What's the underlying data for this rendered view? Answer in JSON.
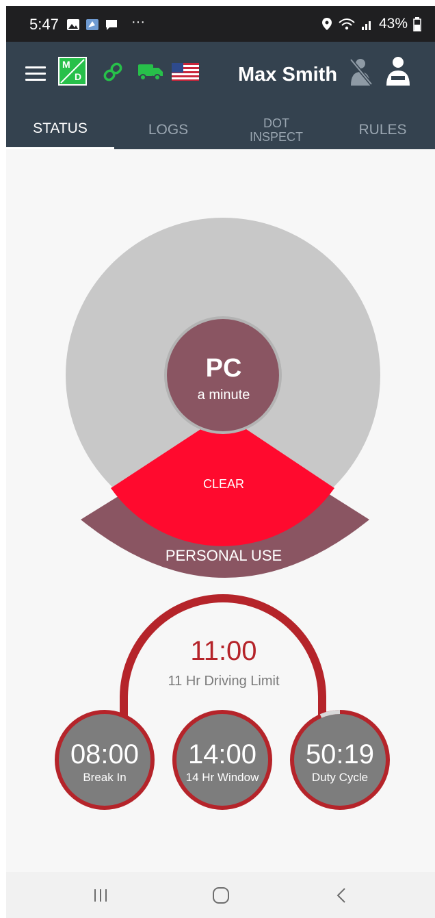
{
  "status_bar": {
    "time": "5:47",
    "overflow": "···",
    "battery": "43%"
  },
  "header": {
    "logo_letter_top": "M",
    "logo_letter_bottom": "D",
    "driver_name": "Max Smith",
    "tabs": [
      {
        "line1": "STATUS",
        "line2": "",
        "active": true
      },
      {
        "line1": "LOGS",
        "line2": "",
        "active": false
      },
      {
        "line1": "DOT",
        "line2": "INSPECT",
        "active": false
      },
      {
        "line1": "RULES",
        "line2": "",
        "active": false
      }
    ]
  },
  "status": {
    "code": "PC",
    "duration": "a minute",
    "clear_label": "CLEAR",
    "personal_use_label": "PERSONAL USE"
  },
  "driving": {
    "time": "11:00",
    "label": "11 Hr Driving Limit"
  },
  "timers": [
    {
      "value": "08:00",
      "label": "Break In"
    },
    {
      "value": "14:00",
      "label": "14 Hr Window"
    },
    {
      "value": "50:19",
      "label": "Duty Cycle"
    }
  ],
  "colors": {
    "header_bg": "#34424f",
    "status_green": "#27c04a",
    "dial_grey": "#c8c8c8",
    "status_maroon": "#8a5562",
    "clear_red": "#ff0a2e",
    "gauge_red": "#b5242a",
    "timer_grey": "#7d7d7d"
  },
  "icons": {
    "status_bar": [
      "image-icon",
      "app-notification-icon",
      "message-icon",
      "location-icon",
      "wifi-icon",
      "signal-icon",
      "battery-icon"
    ],
    "header": [
      "menu-icon",
      "eld-logo-icon",
      "link-icon",
      "truck-icon",
      "us-flag-icon",
      "no-co-driver-icon",
      "driver-icon"
    ],
    "nav": [
      "recent-apps-icon",
      "home-icon",
      "back-icon"
    ]
  }
}
